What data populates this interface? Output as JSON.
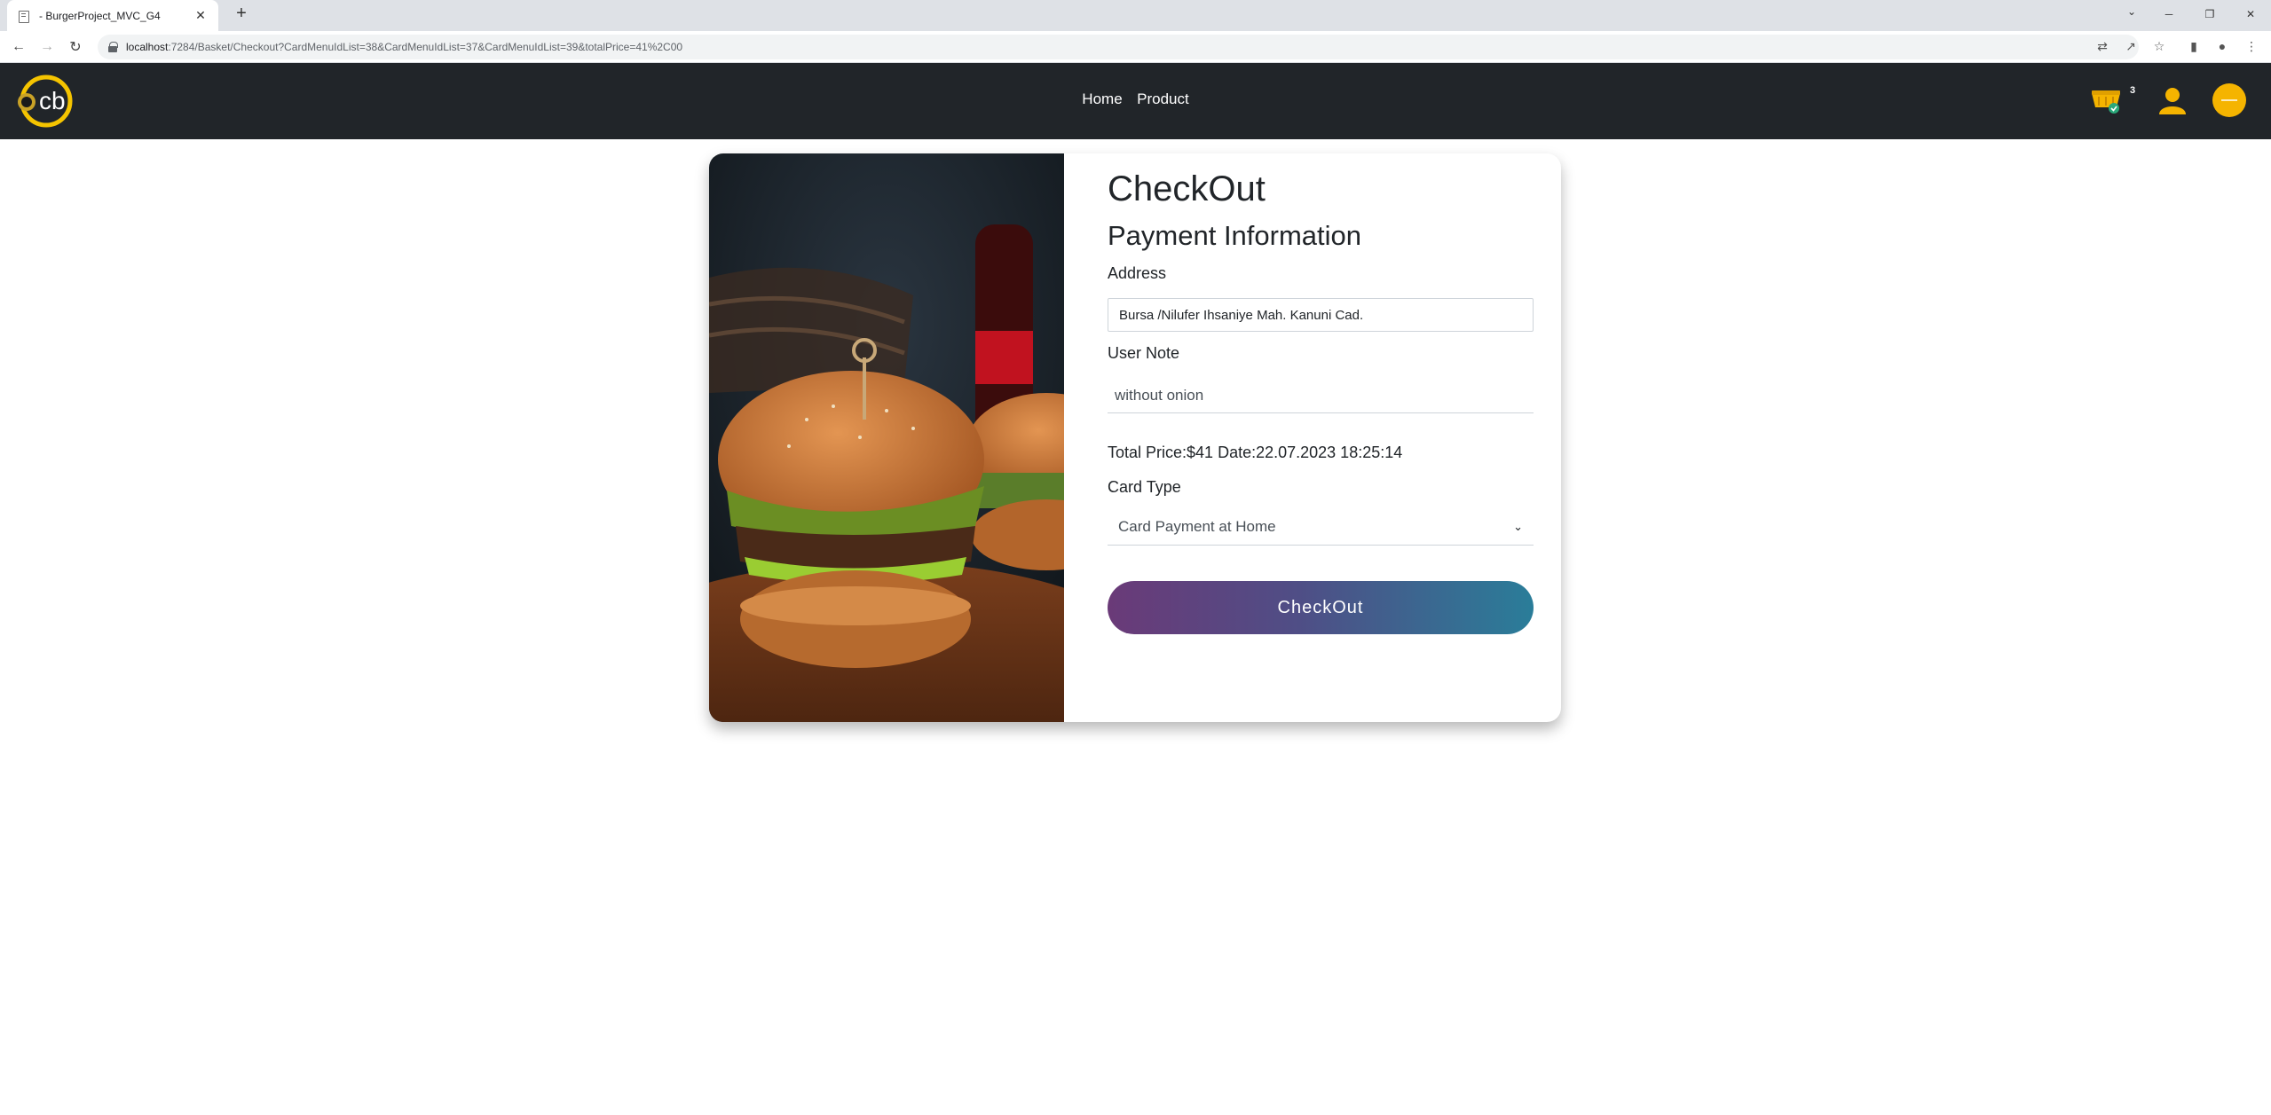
{
  "browser": {
    "tab_title": "- BurgerProject_MVC_G4",
    "new_tab_label": "+",
    "url_host": "localhost",
    "url_rest": ":7284/Basket/Checkout?CardMenuIdList=38&CardMenuIdList=37&CardMenuIdList=39&totalPrice=41%2C00"
  },
  "navbar": {
    "links": [
      "Home",
      "Product"
    ],
    "cart_count": "3",
    "logo_text": "cb",
    "accent_color": "#f5b400"
  },
  "checkout": {
    "title": "CheckOut",
    "subtitle": "Payment Information",
    "address_label": "Address",
    "address_value": "Bursa /Nilufer Ihsaniye Mah. Kanuni Cad.",
    "note_label": "User Note",
    "note_value": "without onion",
    "total_text": "Total Price:$41 Date:22.07.2023 18:25:14",
    "card_type_label": "Card Type",
    "card_type_selected": "Card Payment at Home",
    "button_label": "CheckOut",
    "button_gradient": [
      "#6a3a78",
      "#2a7d99"
    ]
  }
}
